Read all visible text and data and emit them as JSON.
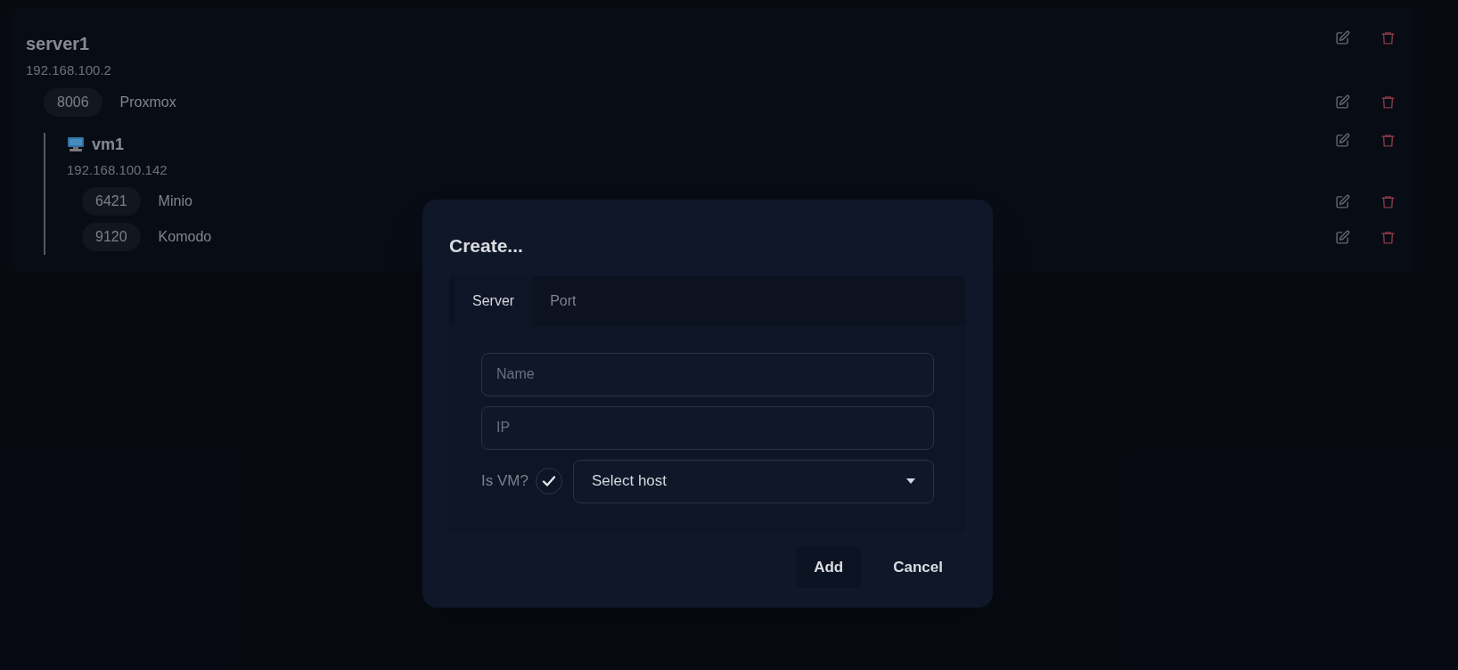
{
  "servers": [
    {
      "name": "server1",
      "ip": "192.168.100.2",
      "is_vm": false,
      "ports": [
        {
          "port": "8006",
          "name": "Proxmox"
        }
      ],
      "children": [
        {
          "name": "vm1",
          "ip": "192.168.100.142",
          "is_vm": true,
          "ports": [
            {
              "port": "6421",
              "name": "Minio"
            },
            {
              "port": "9120",
              "name": "Komodo"
            }
          ]
        }
      ]
    }
  ],
  "dialog": {
    "title": "Create...",
    "tabs": [
      {
        "label": "Server",
        "selected": true
      },
      {
        "label": "Port",
        "selected": false
      }
    ],
    "fields": [
      {
        "placeholder": "Name"
      },
      {
        "placeholder": "IP"
      }
    ],
    "is_vm": {
      "label": "Is VM?",
      "checked": true
    },
    "host_select": {
      "value": "Select host"
    },
    "buttons": [
      {
        "label": "Add",
        "kind": "primary"
      },
      {
        "label": "Cancel",
        "kind": "plain"
      }
    ]
  }
}
